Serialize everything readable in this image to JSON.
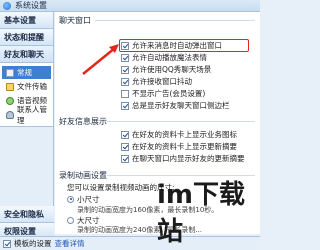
{
  "window": {
    "title": "系统设置"
  },
  "sidebar": {
    "categories": [
      {
        "label": "基本设置"
      },
      {
        "label": "状态和提醒"
      },
      {
        "label": "好友和聊天"
      }
    ],
    "sub_items": [
      {
        "label": "常规",
        "icon": "settings-icon",
        "selected": true
      },
      {
        "label": "文件传输",
        "icon": "folder-icon",
        "selected": false
      },
      {
        "label": "语音视频",
        "icon": "microphone-icon",
        "selected": false
      },
      {
        "label": "联系人管理",
        "icon": "contact-icon",
        "selected": false
      }
    ],
    "security": {
      "label": "安全和隐私"
    },
    "permission": {
      "label": "权限设置"
    }
  },
  "main": {
    "chat_window": {
      "title": "聊天窗口",
      "options": [
        {
          "label": "允许来消息时自动弹出窗口",
          "checked": true
        },
        {
          "label": "允许自动播放魔法表情",
          "checked": true
        },
        {
          "label": "允许使用QQ秀聊天场景",
          "checked": true
        },
        {
          "label": "允许接收窗口抖动",
          "checked": true
        },
        {
          "label": "不显示广告(会员设置)",
          "checked": false
        },
        {
          "label": "总是显示好友聊天窗口侧边栏",
          "checked": true
        }
      ]
    },
    "friend_display": {
      "title": "好友信息展示",
      "options": [
        {
          "label": "在好友的资料卡上显示业务图标",
          "checked": true
        },
        {
          "label": "在好友的资料卡上显示更新摘要",
          "checked": true
        },
        {
          "label": "在聊天窗口内显示好友的更新摘要",
          "checked": true
        }
      ]
    },
    "recording": {
      "title": "录制动画设置",
      "prompt": "您可以设置录制视频动画的尺寸:",
      "options": [
        {
          "label": "小尺寸",
          "selected": true,
          "note": "录制的动画宽度为160像素，最长录制10秒。"
        },
        {
          "label": "大尺寸",
          "selected": false,
          "note": "录制的动画宽度为240像素，最长录制..."
        }
      ]
    }
  },
  "bottom": {
    "checkbox_label": "模板的设置",
    "checked": true,
    "link": "查看详情"
  },
  "watermark": {
    "text": "im下载站",
    "sub": ""
  },
  "colors": {
    "accent": "#3d7fd0",
    "highlight": "#e2261b"
  }
}
